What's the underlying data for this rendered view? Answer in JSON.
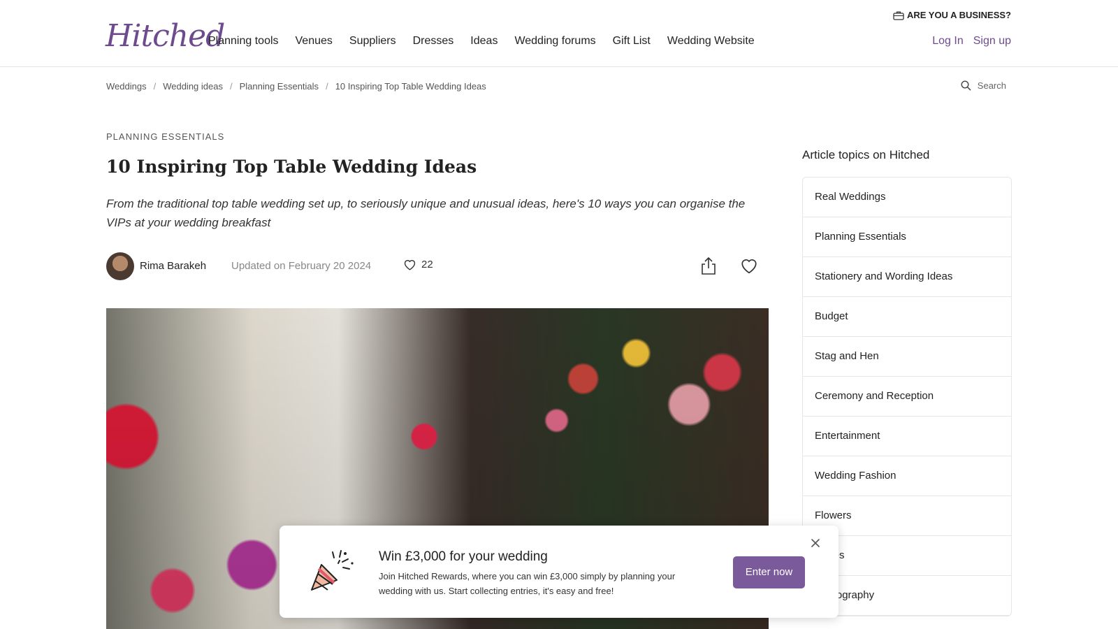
{
  "brand": {
    "logo_text": "Hitched",
    "accent": "#6e4a8e",
    "button_color": "#7b5a9b"
  },
  "header": {
    "nav": [
      "Planning tools",
      "Venues",
      "Suppliers",
      "Dresses",
      "Ideas",
      "Wedding forums",
      "Gift List",
      "Wedding Website"
    ],
    "business_link": "ARE YOU A BUSINESS?",
    "business_icon": "briefcase-icon",
    "login": "Log In",
    "signup": "Sign up"
  },
  "breadcrumb": [
    "Weddings",
    "Wedding ideas",
    "Planning Essentials",
    "10 Inspiring Top Table Wedding Ideas"
  ],
  "search": {
    "label": "Search",
    "icon": "search-icon"
  },
  "article": {
    "category": "PLANNING ESSENTIALS",
    "title": "10 Inspiring Top Table Wedding Ideas",
    "lead": "From the traditional top table wedding set up, to seriously unique and unusual ideas, here's 10 ways you can organise the VIPs at your wedding breakfast",
    "author": "Rima Barakeh",
    "updated": "Updated on February 20 2024",
    "likes": "22",
    "share_icon": "share-icon",
    "favorite_icon": "heart-icon"
  },
  "sidebar": {
    "title": "Article topics on Hitched",
    "topics": [
      "Real Weddings",
      "Planning Essentials",
      "Stationery and Wording Ideas",
      "Budget",
      "Stag and Hen",
      "Ceremony and Reception",
      "Entertainment",
      "Wedding Fashion",
      "Flowers",
      "Cakes",
      "Photography"
    ]
  },
  "promo": {
    "icon": "party-popper-icon",
    "title": "Win £3,000 for your wedding",
    "text": "Join Hitched Rewards, where you can win £3,000 simply by planning your wedding with us. Start collecting entries, it's easy and free!",
    "button": "Enter now",
    "close_icon": "close-icon"
  }
}
